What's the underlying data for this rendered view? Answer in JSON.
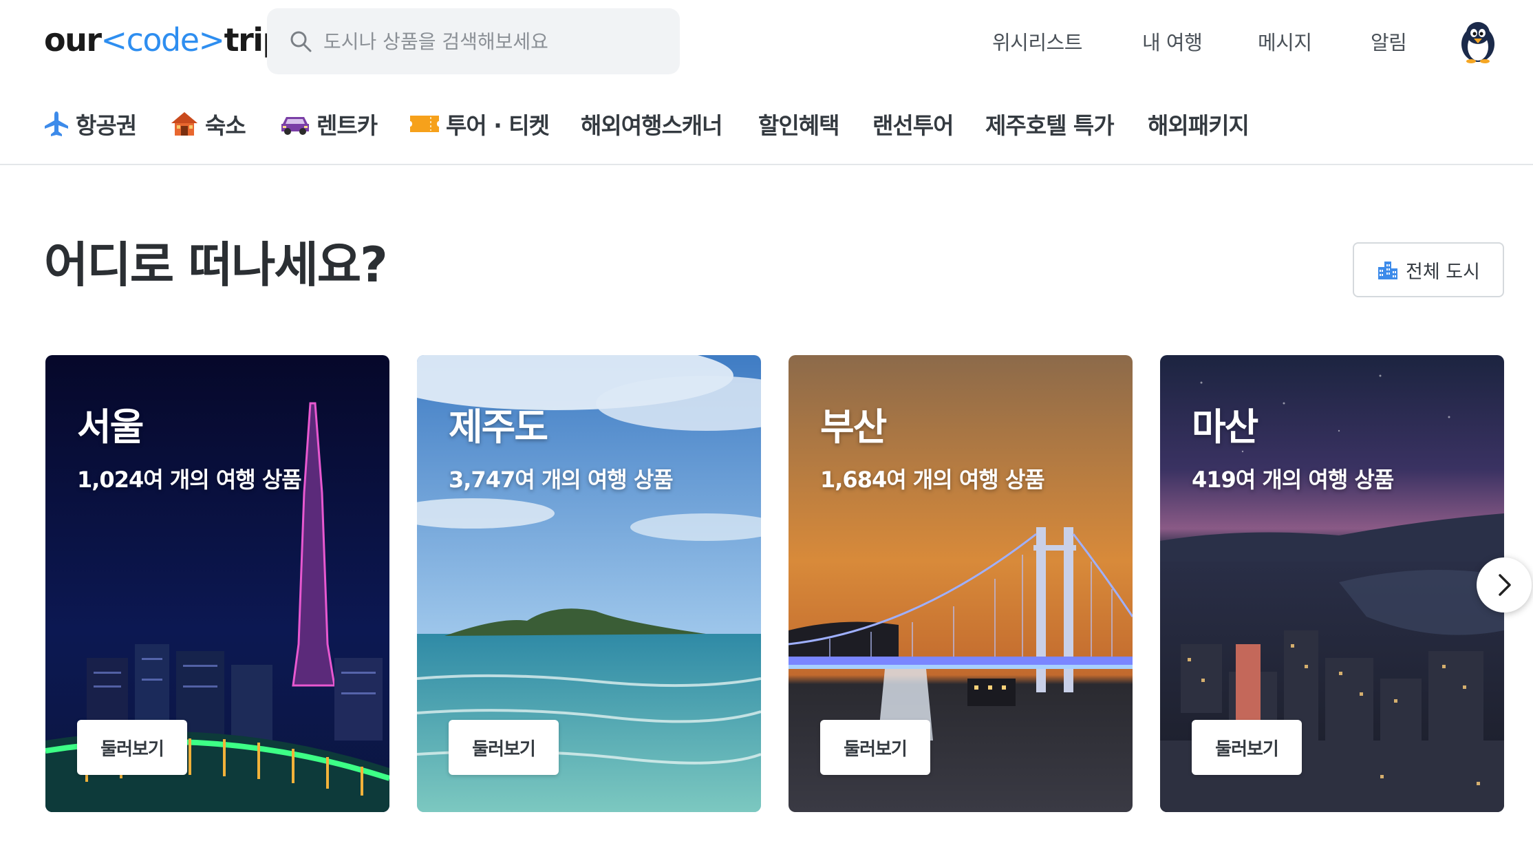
{
  "header": {
    "logo": {
      "left": "our",
      "lt": "<",
      "code": "code",
      "gt": ">",
      "right": "trip"
    },
    "search": {
      "placeholder": "도시나 상품을 검색해보세요",
      "value": ""
    },
    "nav": [
      "위시리스트",
      "내 여행",
      "메시지",
      "알림"
    ]
  },
  "categories": [
    {
      "label": "항공권",
      "icon": "airplane-icon"
    },
    {
      "label": "숙소",
      "icon": "house-icon"
    },
    {
      "label": "렌트카",
      "icon": "car-icon"
    },
    {
      "label": "투어 · 티켓",
      "icon": "ticket-icon"
    },
    {
      "label": "해외여행스캐너"
    },
    {
      "label": "할인혜택"
    },
    {
      "label": "랜선투어"
    },
    {
      "label": "제주호텔 특가"
    },
    {
      "label": "해외패키지"
    }
  ],
  "section": {
    "title": "어디로 떠나세요?",
    "all_cities_label": "전체 도시",
    "all_cities_icon": "city-buildings-icon"
  },
  "cities": [
    {
      "name": "서울",
      "count_text": "1,024여 개의 여행 상품",
      "button": "둘러보기"
    },
    {
      "name": "제주도",
      "count_text": "3,747여 개의 여행 상품",
      "button": "둘러보기"
    },
    {
      "name": "부산",
      "count_text": "1,684여 개의 여행 상품",
      "button": "둘러보기"
    },
    {
      "name": "마산",
      "count_text": "419여 개의 여행 상품",
      "button": "둘러보기"
    }
  ],
  "carousel": {
    "next_icon": "chevron-right-icon"
  },
  "colors": {
    "accent": "#2e8ef0",
    "text": "#2b2f33",
    "search_bg": "#f1f3f5"
  }
}
